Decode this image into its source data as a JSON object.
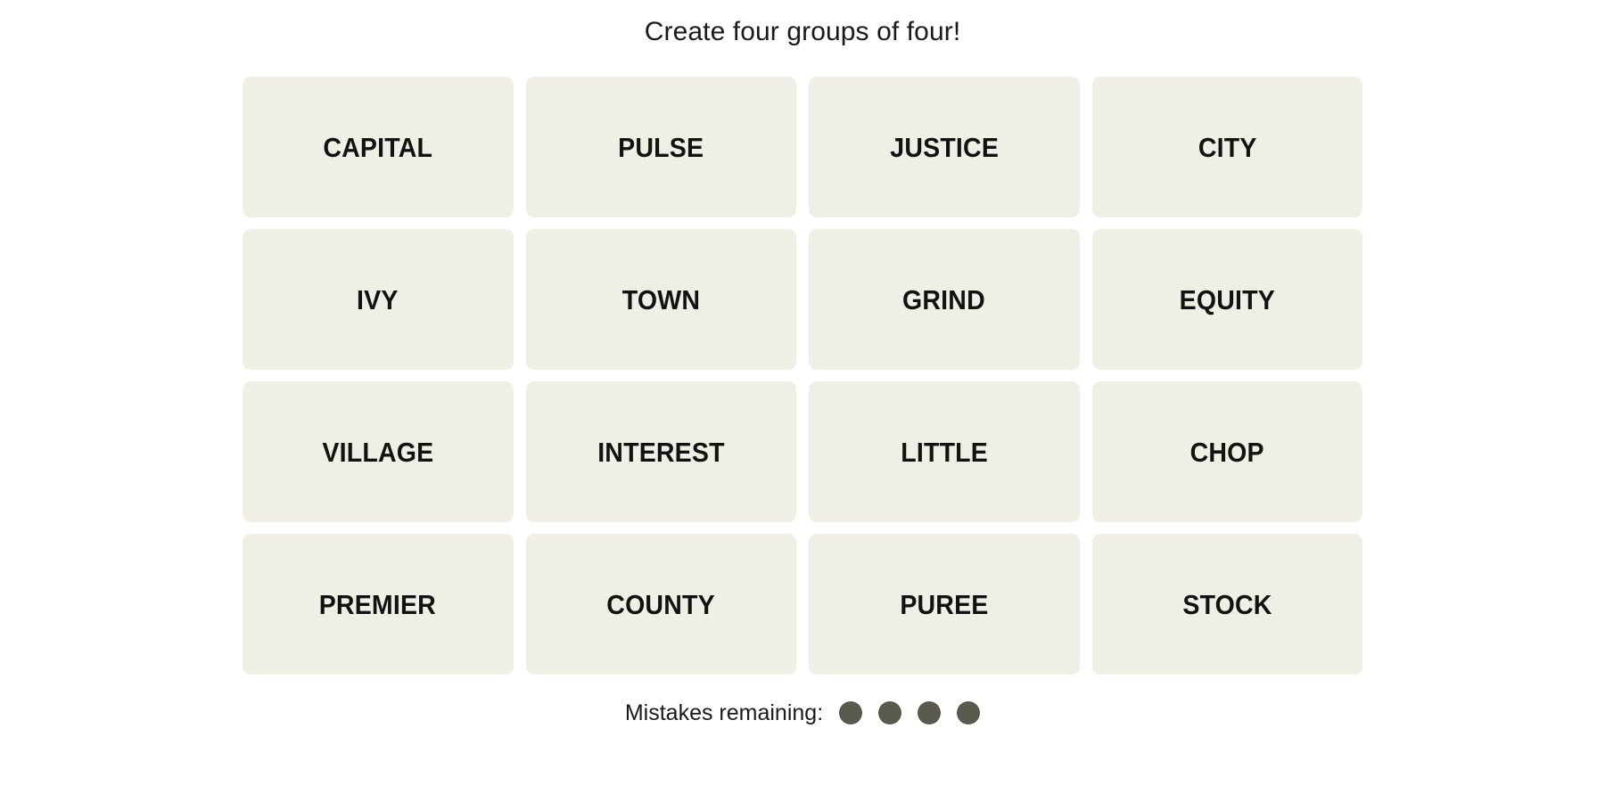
{
  "header": {
    "title": "Create four groups of four!"
  },
  "board": {
    "rows": 4,
    "columns": 4,
    "tile_color": "#EFEFE6",
    "tile_text_color": "#121212",
    "tiles": [
      "CAPITAL",
      "PULSE",
      "JUSTICE",
      "CITY",
      "IVY",
      "TOWN",
      "GRIND",
      "EQUITY",
      "VILLAGE",
      "INTEREST",
      "LITTLE",
      "CHOP",
      "PREMIER",
      "COUNTY",
      "PUREE",
      "STOCK"
    ]
  },
  "footer": {
    "mistakes_label": "Mistakes remaining:",
    "mistakes_remaining": 4,
    "dot_color": "#5A594E"
  }
}
